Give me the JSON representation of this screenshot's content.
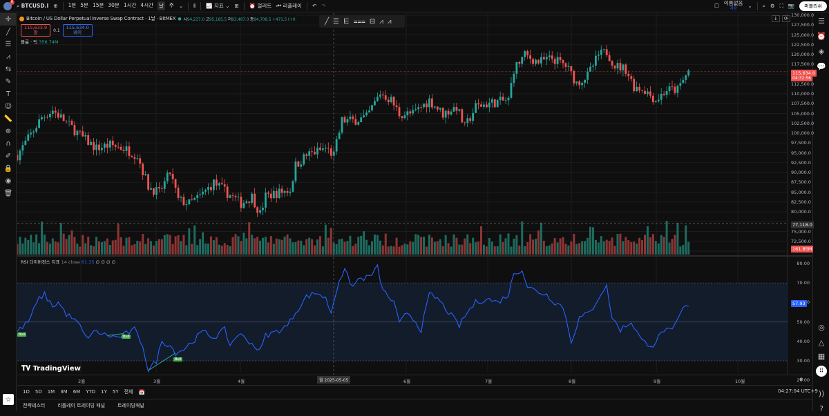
{
  "topbar": {
    "symbol": "BTCUSD.I",
    "intervals": [
      "1분",
      "5분",
      "15분",
      "30분",
      "1시간",
      "4시간",
      "날",
      "주"
    ],
    "active_interval": "날",
    "indicators": "지표",
    "alert": "얼러트",
    "replay": "리플레이",
    "layout_name": "이름없음",
    "layout_sub": "저장",
    "publish": "퍼블리쉬",
    "avatar_badge": "8"
  },
  "legend": {
    "title": "Bitcoin / US Dollar Perpetual Inverse Swap Contract · 1날 · BitMEX",
    "o_label": "시",
    "o": "94,237.0",
    "h_label": "고",
    "h": "95,185.5",
    "l_label": "저",
    "l": "93,487.0",
    "c_label": "종",
    "c": "94,708.5",
    "change": "+471.5 (+0.",
    "sell_price": "115,633.9",
    "sell_label": "팔",
    "spread": "0.1",
    "buy_price": "115,634.0",
    "buy_label": "바이",
    "volume_label": "볼륨 · 틱",
    "volume_value": "356.74M"
  },
  "rsi_legend": {
    "name": "RSI 다이버전스 지표",
    "params": "14 close",
    "value": "61.35",
    "extras": "∅ ∅ ∅ ∅"
  },
  "price_axis": [
    "130,000.0",
    "127,500.0",
    "125,000.0",
    "122,500.0",
    "120,000.0",
    "117,500.0",
    "112,500.0",
    "110,000.0",
    "107,500.0",
    "105,000.0",
    "102,500.0",
    "100,000.0",
    "97,500.0",
    "95,000.0",
    "92,500.0",
    "90,000.0",
    "87,500.0",
    "85,000.0",
    "82,500.0",
    "80,000.0",
    "75,000.0",
    "72,500.0",
    "70,000.0"
  ],
  "last_price": {
    "value": "115,634.0",
    "countdown": "04:32:56"
  },
  "crosshair_price": "77,118.0",
  "volume_tag": "161.85M",
  "rsi_axis": [
    "80.00",
    "70.00",
    "60.00",
    "50.00",
    "40.00",
    "30.00",
    "20.00"
  ],
  "rsi_last": "57.93",
  "bull_labels": [
    "Bull",
    "Bull",
    "Bull"
  ],
  "time_axis": [
    "2월",
    "3월",
    "4월",
    "6월",
    "7월",
    "8월",
    "9월",
    "10월"
  ],
  "crosshair_date": "월 2025-05-05",
  "clock": "04:27:04 UTC+9",
  "range_buttons": [
    "1D",
    "5D",
    "1M",
    "3M",
    "6M",
    "YTD",
    "1Y",
    "5Y",
    "전체"
  ],
  "bottom_tabs": [
    "전략테스터",
    "리플레이 트레이딩 패널",
    "트레이딩패널"
  ],
  "watermark": "TradingView",
  "colors": {
    "up": "#26a69a",
    "down": "#ef5350",
    "rsi": "#2962ff",
    "bg": "#0f0f0f"
  },
  "chart_data": {
    "type": "candlestick",
    "symbol": "BTCUSD",
    "interval": "1D",
    "ylim": [
      70000,
      130000
    ],
    "key_closes_day_price": [
      [
        0,
        94400
      ],
      [
        5,
        99650
      ],
      [
        9,
        104000
      ],
      [
        13,
        105800
      ],
      [
        16,
        104000
      ],
      [
        20,
        101400
      ],
      [
        24,
        98800
      ],
      [
        29,
        96150
      ],
      [
        34,
        97000
      ],
      [
        39,
        96150
      ],
      [
        44,
        94400
      ],
      [
        48,
        86500
      ],
      [
        52,
        84750
      ],
      [
        56,
        90000
      ],
      [
        59,
        83000
      ],
      [
        63,
        82100
      ],
      [
        67,
        83900
      ],
      [
        72,
        87400
      ],
      [
        77,
        84750
      ],
      [
        82,
        82100
      ],
      [
        86,
        83900
      ],
      [
        89,
        79500
      ],
      [
        91,
        83900
      ],
      [
        95,
        84750
      ],
      [
        100,
        85600
      ],
      [
        102,
        91800
      ],
      [
        106,
        94400
      ],
      [
        113,
        96150
      ],
      [
        116,
        94400
      ],
      [
        119,
        103200
      ],
      [
        123,
        103200
      ],
      [
        128,
        104000
      ],
      [
        133,
        110200
      ],
      [
        137,
        108400
      ],
      [
        140,
        104900
      ],
      [
        145,
        104900
      ],
      [
        151,
        108400
      ],
      [
        156,
        104900
      ],
      [
        161,
        106700
      ],
      [
        164,
        101400
      ],
      [
        168,
        106700
      ],
      [
        173,
        107600
      ],
      [
        180,
        108400
      ],
      [
        182,
        116300
      ],
      [
        186,
        119800
      ],
      [
        191,
        118100
      ],
      [
        196,
        119000
      ],
      [
        201,
        117200
      ],
      [
        205,
        112800
      ],
      [
        209,
        114600
      ],
      [
        213,
        119800
      ],
      [
        216,
        120700
      ],
      [
        219,
        117200
      ],
      [
        223,
        116300
      ],
      [
        226,
        111900
      ],
      [
        230,
        111000
      ],
      [
        234,
        108400
      ],
      [
        238,
        111000
      ],
      [
        242,
        111000
      ],
      [
        246,
        115800
      ]
    ],
    "rsi_key_day_value": [
      [
        0,
        45
      ],
      [
        4,
        50
      ],
      [
        8,
        62
      ],
      [
        10,
        64
      ],
      [
        13,
        58
      ],
      [
        15,
        60
      ],
      [
        18,
        54
      ],
      [
        20,
        52
      ],
      [
        23,
        48
      ],
      [
        25,
        42
      ],
      [
        29,
        45
      ],
      [
        33,
        43
      ],
      [
        37,
        42
      ],
      [
        40,
        44
      ],
      [
        43,
        46
      ],
      [
        46,
        38
      ],
      [
        48,
        25
      ],
      [
        51,
        30
      ],
      [
        53,
        40
      ],
      [
        56,
        38
      ],
      [
        58,
        34
      ],
      [
        61,
        36
      ],
      [
        65,
        41
      ],
      [
        68,
        45
      ],
      [
        72,
        42
      ],
      [
        76,
        46
      ],
      [
        78,
        38
      ],
      [
        81,
        44
      ],
      [
        85,
        40
      ],
      [
        89,
        35
      ],
      [
        91,
        43
      ],
      [
        95,
        45
      ],
      [
        99,
        48
      ],
      [
        102,
        55
      ],
      [
        106,
        63
      ],
      [
        110,
        65
      ],
      [
        113,
        62
      ],
      [
        115,
        55
      ],
      [
        118,
        72
      ],
      [
        120,
        76
      ],
      [
        123,
        68
      ],
      [
        125,
        72
      ],
      [
        129,
        73
      ],
      [
        132,
        78
      ],
      [
        134,
        66
      ],
      [
        138,
        60
      ],
      [
        140,
        49
      ],
      [
        143,
        55
      ],
      [
        145,
        52
      ],
      [
        148,
        46
      ],
      [
        151,
        64
      ],
      [
        154,
        62
      ],
      [
        158,
        55
      ],
      [
        162,
        48
      ],
      [
        165,
        55
      ],
      [
        168,
        60
      ],
      [
        172,
        62
      ],
      [
        176,
        60
      ],
      [
        180,
        64
      ],
      [
        182,
        75
      ],
      [
        185,
        77
      ],
      [
        187,
        68
      ],
      [
        190,
        66
      ],
      [
        194,
        64
      ],
      [
        197,
        60
      ],
      [
        200,
        58
      ],
      [
        203,
        40
      ],
      [
        206,
        52
      ],
      [
        210,
        55
      ],
      [
        214,
        65
      ],
      [
        216,
        68
      ],
      [
        218,
        52
      ],
      [
        221,
        46
      ],
      [
        225,
        50
      ],
      [
        229,
        40
      ],
      [
        233,
        38
      ],
      [
        237,
        46
      ],
      [
        240,
        45
      ],
      [
        244,
        57
      ],
      [
        246,
        58
      ]
    ],
    "rsi_bands": [
      30,
      70
    ],
    "rsi_ylim": [
      20,
      80
    ]
  }
}
